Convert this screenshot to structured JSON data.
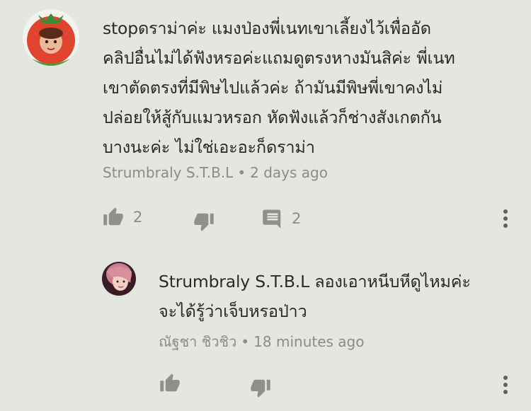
{
  "comment": {
    "text_lines": [
      "stopดราม่าค่ะ แมงป่องพี่เนทเขาเลี้ยงไว้เพื่ออัด",
      "คลิปอื่นไม่ได้ฟังหรอค่ะแถมดูตรงหางมันสิค่ะ พี่เนท",
      "เขาตัดตรงที่มีพิษไปแล้วค่ะ ถ้ามันมีพิษพี่เขาคงไม่",
      "ปล่อยให้สู้กับแมวหรอก หัดฟังแล้วก็ช่างสังเกตกัน",
      "บางนะค่ะ ไม่ใช่เอะอะก็ดราม่า"
    ],
    "author": "Strumbraly S.T.B.L",
    "separator": "•",
    "time": "2 days ago",
    "likes": "2",
    "replies": "2"
  },
  "reply": {
    "text_lines": [
      "Strumbraly S.T.B.L ลองเอาหนีบหีดูไหมค่ะ",
      "จะได้รู้ว่าเจ็บหรอป่าว"
    ],
    "author": "ณัฐชา ชิวชิว",
    "separator": "•",
    "time": "18 minutes ago"
  },
  "colors": {
    "background": "#e4e6e1",
    "text": "#2a2a2a",
    "meta": "#8a8c88",
    "icon": "#8e908c"
  }
}
